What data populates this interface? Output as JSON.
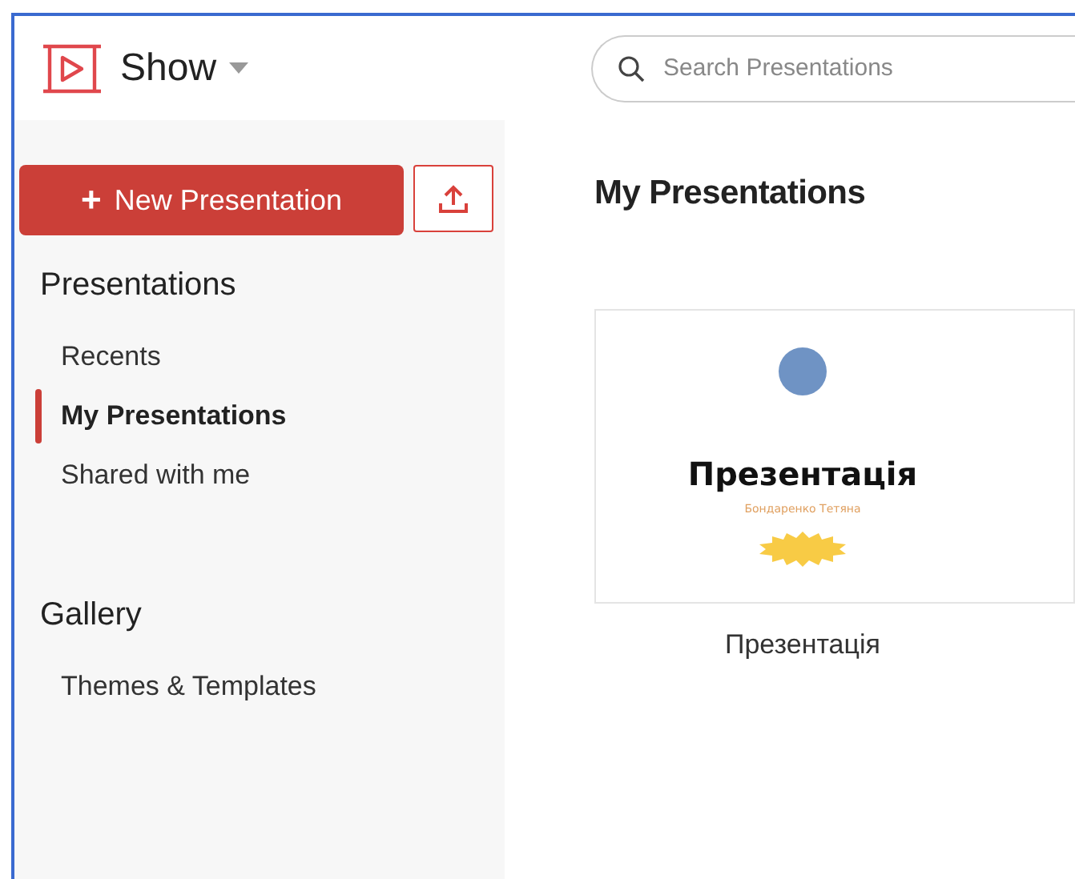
{
  "app": {
    "name": "Show"
  },
  "search": {
    "placeholder": "Search Presentations"
  },
  "sidebar": {
    "new_button": "New Presentation",
    "new_icon": "+",
    "sections": [
      {
        "title": "Presentations",
        "items": [
          {
            "label": "Recents",
            "selected": false
          },
          {
            "label": "My Presentations",
            "selected": true
          },
          {
            "label": "Shared with me",
            "selected": false
          }
        ]
      },
      {
        "title": "Gallery",
        "items": [
          {
            "label": "Themes & Templates",
            "selected": false
          }
        ]
      }
    ]
  },
  "main": {
    "title": "My Presentations",
    "files": [
      {
        "name": "Презентація",
        "slide": {
          "title": "Презентація",
          "subtitle": "Бондаренко Тетяна"
        }
      }
    ]
  }
}
